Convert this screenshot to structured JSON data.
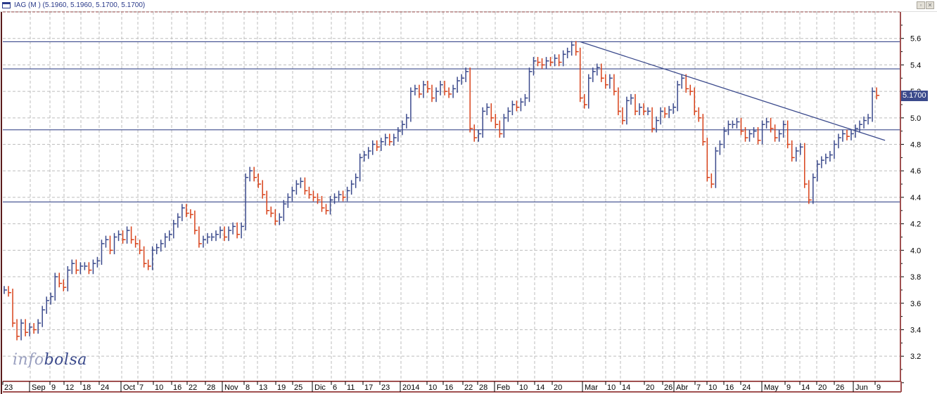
{
  "window": {
    "title": "IAG (M ) (5.1960, 5.1960, 5.1700, 5.1700)",
    "restore_icon": "restore-icon",
    "close_icon": "close-icon"
  },
  "logo": {
    "part1": "info",
    "part2": "bolsa"
  },
  "colors": {
    "up": "#3b4a8c",
    "down": "#d8421a",
    "grid": "#bdbdbd",
    "frame": "#a05050",
    "line": "#3b4a8c"
  },
  "chart_data": {
    "type": "ohlc-bar",
    "symbol": "IAG",
    "last_price_label": "5.1700",
    "ylim": [
      3.01,
      5.8
    ],
    "y_ticks": [
      "3.2",
      "3.4",
      "3.6",
      "3.8",
      "4.0",
      "4.2",
      "4.4",
      "4.6",
      "4.8",
      "5.0",
      "5.2",
      "5.4",
      "5.6"
    ],
    "grid": true,
    "x_labels": [
      "23",
      "Sep",
      "9",
      "12",
      "18",
      "24",
      "Oct",
      "7",
      "10",
      "16",
      "22",
      "28",
      "Nov",
      "8",
      "13",
      "19",
      "25",
      "Dic",
      "6",
      "11",
      "17",
      "23",
      "2014",
      "10",
      "16",
      "22",
      "28",
      "Feb",
      "10",
      "14",
      "20",
      "Mar",
      "10",
      "14",
      "20",
      "26",
      "Abr",
      "7",
      "10",
      "16",
      "24",
      "May",
      "9",
      "14",
      "20",
      "26",
      "Jun",
      "9"
    ],
    "closes": [
      3.7,
      3.68,
      3.45,
      3.35,
      3.45,
      3.38,
      3.42,
      3.4,
      3.45,
      3.55,
      3.62,
      3.65,
      3.8,
      3.75,
      3.72,
      3.85,
      3.9,
      3.85,
      3.88,
      3.88,
      3.85,
      3.9,
      3.92,
      4.05,
      4.08,
      4.0,
      4.1,
      4.12,
      4.08,
      4.15,
      4.08,
      4.05,
      4.0,
      3.9,
      3.88,
      4.0,
      4.02,
      4.05,
      4.1,
      4.12,
      4.2,
      4.25,
      4.32,
      4.28,
      4.27,
      4.15,
      4.05,
      4.08,
      4.1,
      4.1,
      4.12,
      4.15,
      4.1,
      4.15,
      4.18,
      4.12,
      4.18,
      4.55,
      4.6,
      4.55,
      4.5,
      4.42,
      4.3,
      4.28,
      4.22,
      4.25,
      4.35,
      4.4,
      4.45,
      4.5,
      4.52,
      4.45,
      4.42,
      4.4,
      4.38,
      4.32,
      4.3,
      4.38,
      4.4,
      4.42,
      4.4,
      4.45,
      4.5,
      4.55,
      4.7,
      4.72,
      4.75,
      4.8,
      4.78,
      4.82,
      4.85,
      4.82,
      4.85,
      4.9,
      4.95,
      5.0,
      5.2,
      5.22,
      5.18,
      5.25,
      5.22,
      5.15,
      5.2,
      5.25,
      5.2,
      5.18,
      5.22,
      5.28,
      5.3,
      5.35,
      4.92,
      4.85,
      4.88,
      5.05,
      5.08,
      5.0,
      4.95,
      4.88,
      5.0,
      5.05,
      5.1,
      5.08,
      5.12,
      5.15,
      5.35,
      5.43,
      5.42,
      5.4,
      5.43,
      5.42,
      5.45,
      5.42,
      5.48,
      5.5,
      5.55,
      5.5,
      5.15,
      5.1,
      5.3,
      5.35,
      5.38,
      5.3,
      5.25,
      5.3,
      5.2,
      5.05,
      4.98,
      5.13,
      5.15,
      5.05,
      5.08,
      5.05,
      5.05,
      4.92,
      4.98,
      5.05,
      5.03,
      5.06,
      5.08,
      5.25,
      5.3,
      5.22,
      5.2,
      5.05,
      5.0,
      4.82,
      4.55,
      4.5,
      4.75,
      4.8,
      4.9,
      4.95,
      4.95,
      4.97,
      4.9,
      4.85,
      4.88,
      4.9,
      4.83,
      4.95,
      4.97,
      4.92,
      4.85,
      4.88,
      4.95,
      4.8,
      4.7,
      4.75,
      4.78,
      4.5,
      4.38,
      4.55,
      4.65,
      4.68,
      4.7,
      4.72,
      4.8,
      4.85,
      4.88,
      4.86,
      4.88,
      4.92,
      4.95,
      4.98,
      5.0,
      5.2,
      5.17
    ],
    "horizontal_lines": [
      5.575,
      5.37,
      4.91,
      4.365
    ],
    "trendline": {
      "from": {
        "bar": 136,
        "price": 5.575
      },
      "to": {
        "bar": 207,
        "price": 4.83
      }
    }
  }
}
